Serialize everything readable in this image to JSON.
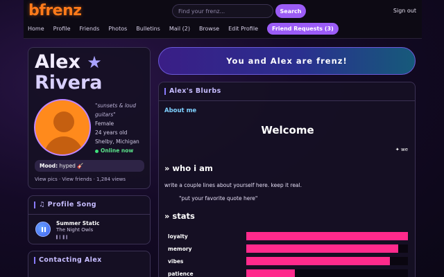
{
  "brand": {
    "logo": "bfrenz"
  },
  "search": {
    "placeholder": "Find your frenz...",
    "button": "Search"
  },
  "header": {
    "signout": "Sign out"
  },
  "nav": {
    "items": [
      "Home",
      "Profile",
      "Friends",
      "Photos",
      "Bulletins",
      "Mail (2)",
      "Browse",
      "Edit Profile"
    ],
    "active": "Friend Requests (3)"
  },
  "profile": {
    "first_name": "Alex",
    "star": "★",
    "last_name": "Rivera",
    "tagline": "\"sunsets & loud guitars\"",
    "gender": "Female",
    "age": "24 years old",
    "location": "Shelby, Michigan",
    "status": "Online now",
    "mood_label": "Mood:",
    "mood_value": "hyped 🎸",
    "links": "View pics · View friends · 1,284 views"
  },
  "song": {
    "section_title": "♫ Profile Song",
    "title": "Summer Static",
    "artist": "The Night Owls",
    "bars_glyph": "▌▎▌▍"
  },
  "contact": {
    "section_title": "Contacting Alex"
  },
  "banner": {
    "text": "You and Alex are frenz!"
  },
  "blurbs": {
    "section_title": "Alex's Blurbs",
    "about_label": "About me",
    "welcome": "Welcome",
    "marquee": "✦ we",
    "who_heading": "» who i am",
    "description": "write a couple lines about yourself here. keep it real.",
    "quote": "\"put your favorite quote here\"",
    "stats_heading": "» stats",
    "stats": [
      {
        "label": "loyalty",
        "value": 1.0
      },
      {
        "label": "memory",
        "value": 0.94
      },
      {
        "label": "vibes",
        "value": 0.89
      },
      {
        "label": "patience",
        "value": 0.3
      }
    ]
  },
  "colors": {
    "accent": "#9b5cf6",
    "logo": "#ff7a1a",
    "stat_fill": "#ff2a8c",
    "about": "#7fd1ff"
  }
}
